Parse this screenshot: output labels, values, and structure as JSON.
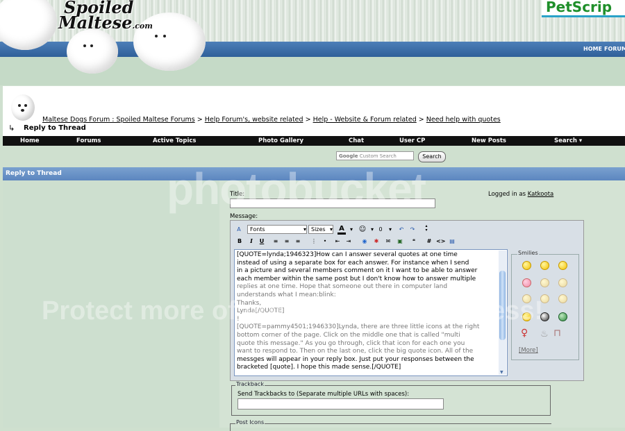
{
  "header": {
    "logo_line1": "Spoiled",
    "logo_line2": "Maltese",
    "logo_suffix": ".com",
    "partner": "PetScrip",
    "links": [
      "HOME",
      "FORUM"
    ]
  },
  "breadcrumb": {
    "items": [
      "Maltese Dogs Forum : Spoiled Maltese Forums",
      "Help Forum's, website related",
      "Help - Website & Forum related",
      "Need help with quotes"
    ],
    "separator": ">",
    "current": "Reply to Thread"
  },
  "navbar": [
    "Home",
    "Forums",
    "Active Topics",
    "Photo Gallery",
    "Chat",
    "User CP",
    "New Posts",
    "Search"
  ],
  "search": {
    "placeholder": "Custom Search",
    "google": "Google",
    "button": "Search"
  },
  "section_title": "Reply to Thread",
  "form": {
    "title_label": "Title:",
    "logged_in_prefix": "Logged in as",
    "username": "Katkoota",
    "message_label": "Message:",
    "font_select": "Fonts",
    "size_select": "Sizes",
    "message_lines": [
      "[QUOTE=lynda;1946323]How can I answer several quotes at one time",
      "instead of using a separate box for each answer.   For instance when I send",
      "in a picture and several members comment on it I want to be able to answer",
      "each member within the same post but I don't know how to answer multiple",
      "replies at one time.  Hope that someone out there in computer land",
      "understands what I mean:blink:",
      "Thanks,",
      "Lynda[/QUOTE]",
      "!",
      "[QUOTE=pammy4501;1946330]Lynda, there are three little icons at the right",
      "bottom corner of the page.  Click on the middle one that is called \"multi",
      "quote this message.\"  As you go through, click that icon  for each one you",
      "want to respond to.  Then on the last one, click the big quote icon.  All of the",
      "messges will appear in your reply box.  Just put your responses between the",
      "bracketed [quote].  I hope this made sense.[/QUOTE]"
    ],
    "smilies_title": "Smilies",
    "more_link": "[More]",
    "trackback_title": "Trackback",
    "trackback_label": "Send Trackbacks to (Separate multiple URLs with spaces):",
    "post_icons_title": "Post Icons"
  },
  "watermark": {
    "line1": "photobucket",
    "line2": "Protect more of your memories for less!"
  }
}
